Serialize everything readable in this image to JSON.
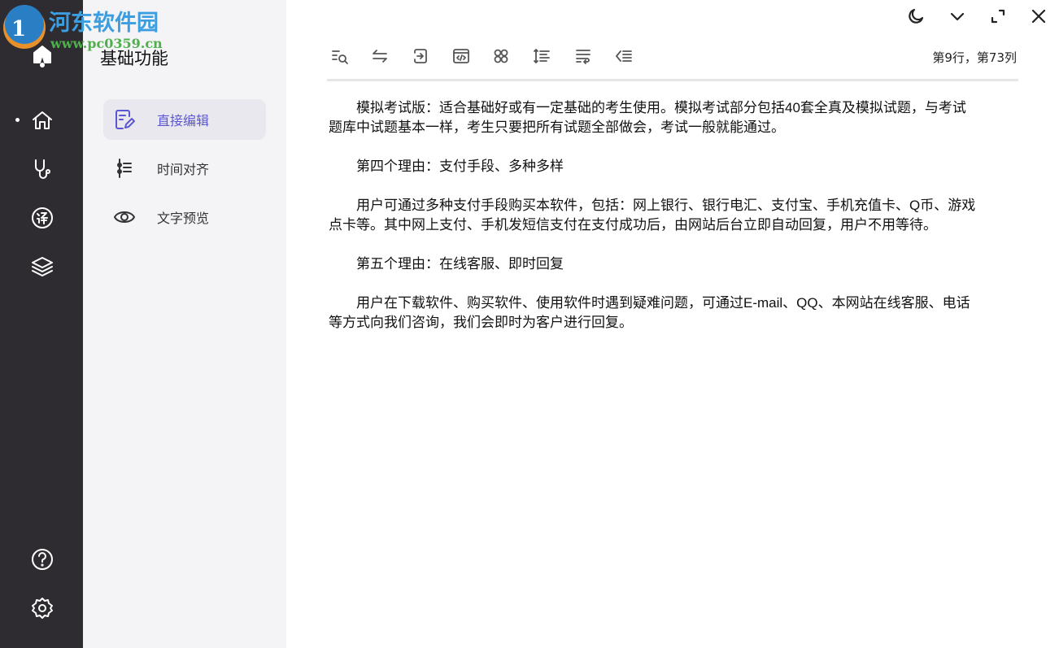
{
  "watermark": {
    "name": "河东软件园",
    "url": "www.pc0359.cn"
  },
  "panel": {
    "title": "基础功能",
    "items": [
      {
        "label": "直接编辑",
        "icon": "edit-icon",
        "active": true
      },
      {
        "label": "时间对齐",
        "icon": "timeline-icon"
      },
      {
        "label": "文字预览",
        "icon": "eye-icon"
      }
    ]
  },
  "rail": {
    "icons": [
      "app-logo",
      "home-icon",
      "stethoscope-icon",
      "translate-icon",
      "layers-icon",
      "help-icon",
      "settings-icon"
    ]
  },
  "toolbar": {
    "icons": [
      "find-icon",
      "swap-icon",
      "import-icon",
      "code-icon",
      "apps-icon",
      "line-spacing-icon",
      "wrap-icon",
      "outdent-icon"
    ]
  },
  "window": {
    "icons": [
      "moon-icon",
      "chevron-down-icon",
      "maximize-icon",
      "close-icon"
    ]
  },
  "status": {
    "position": "第9行，第73列"
  },
  "editor": {
    "lines": [
      "　　模拟考试版：适合基础好或有一定基础的考生使用。模拟考试部分包括40套全真及模拟试题，与考试",
      "题库中试题基本一样，考生只要把所有试题全部做会，考试一般就能通过。",
      "　　第四个理由：支付手段、多种多样",
      "　　用户可通过多种支付手段购买本软件，包括：网上银行、银行电汇、支付宝、手机充值卡、Q币、游戏",
      "点卡等。其中网上支付、手机发短信支付在支付成功后，由网站后台立即自动回复，用户不用等待。",
      "　　第五个理由：在线客服、即时回复",
      "　　用户在下载软件、购买软件、使用软件时遇到疑难问题，可通过E-mail、QQ、本网站在线客服、电话",
      "等方式向我们咨询，我们会即时为客户进行回复。"
    ]
  },
  "colors": {
    "accent": "#5b57d1",
    "rail": "#2e2c30",
    "panel": "#f4f3f6"
  }
}
